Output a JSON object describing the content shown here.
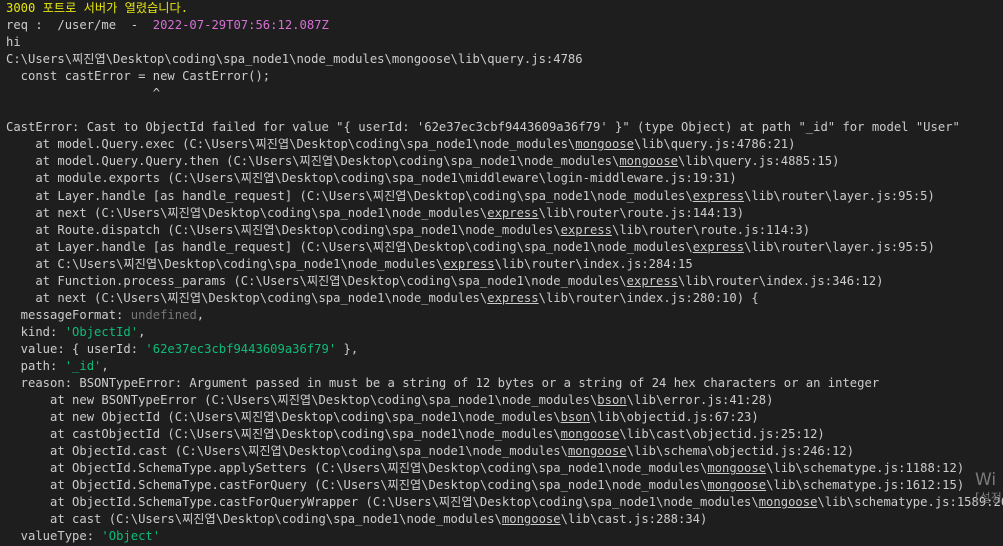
{
  "colors": {
    "background": "#1e1e1e",
    "text": "#cccccc",
    "yellow": "#e5e510",
    "magenta": "#d670d6",
    "green": "#0dbc79",
    "gray": "#767676"
  },
  "lines": [
    [
      {
        "t": "3000 포트로 서버가 열렸습니다.",
        "c": "yellow"
      }
    ],
    [
      {
        "t": "req :  /user/me  -  "
      },
      {
        "t": "2022-07-29T07:56:12.087Z",
        "c": "magenta"
      }
    ],
    [
      {
        "t": "hi"
      }
    ],
    [
      {
        "t": "C:\\Users\\찌진엽\\Desktop\\coding\\spa_node1\\node_modules\\mongoose\\lib\\query.js:4786"
      }
    ],
    [
      {
        "t": "  const castError = new CastError();"
      }
    ],
    [
      {
        "t": "                    ^"
      }
    ],
    [
      {
        "t": ""
      }
    ],
    [
      {
        "t": "CastError: Cast to ObjectId failed for value \"{ userId: '62e37ec3cbf9443609a36f79' }\" (type Object) at path \"_id\" for model \"User\""
      }
    ],
    [
      {
        "t": "    at model.Query.exec (C:\\Users\\찌진엽\\Desktop\\coding\\spa_node1\\node_modules\\"
      },
      {
        "t": "mongoose",
        "u": true
      },
      {
        "t": "\\lib\\query.js:4786:21)"
      }
    ],
    [
      {
        "t": "    at model.Query.Query.then (C:\\Users\\찌진엽\\Desktop\\coding\\spa_node1\\node_modules\\"
      },
      {
        "t": "mongoose",
        "u": true
      },
      {
        "t": "\\lib\\query.js:4885:15)"
      }
    ],
    [
      {
        "t": "    at module.exports (C:\\Users\\찌진엽\\Desktop\\coding\\spa_node1\\middleware\\login-middleware.js:19:31)"
      }
    ],
    [
      {
        "t": "    at Layer.handle [as handle_request] (C:\\Users\\찌진엽\\Desktop\\coding\\spa_node1\\node_modules\\"
      },
      {
        "t": "express",
        "u": true
      },
      {
        "t": "\\lib\\router\\layer.js:95:5)"
      }
    ],
    [
      {
        "t": "    at next (C:\\Users\\찌진엽\\Desktop\\coding\\spa_node1\\node_modules\\"
      },
      {
        "t": "express",
        "u": true
      },
      {
        "t": "\\lib\\router\\route.js:144:13)"
      }
    ],
    [
      {
        "t": "    at Route.dispatch (C:\\Users\\찌진엽\\Desktop\\coding\\spa_node1\\node_modules\\"
      },
      {
        "t": "express",
        "u": true
      },
      {
        "t": "\\lib\\router\\route.js:114:3)"
      }
    ],
    [
      {
        "t": "    at Layer.handle [as handle_request] (C:\\Users\\찌진엽\\Desktop\\coding\\spa_node1\\node_modules\\"
      },
      {
        "t": "express",
        "u": true
      },
      {
        "t": "\\lib\\router\\layer.js:95:5)"
      }
    ],
    [
      {
        "t": "    at C:\\Users\\찌진엽\\Desktop\\coding\\spa_node1\\node_modules\\"
      },
      {
        "t": "express",
        "u": true
      },
      {
        "t": "\\lib\\router\\index.js:284:15"
      }
    ],
    [
      {
        "t": "    at Function.process_params (C:\\Users\\찌진엽\\Desktop\\coding\\spa_node1\\node_modules\\"
      },
      {
        "t": "express",
        "u": true
      },
      {
        "t": "\\lib\\router\\index.js:346:12)"
      }
    ],
    [
      {
        "t": "    at next (C:\\Users\\찌진엽\\Desktop\\coding\\spa_node1\\node_modules\\"
      },
      {
        "t": "express",
        "u": true
      },
      {
        "t": "\\lib\\router\\index.js:280:10) {"
      }
    ],
    [
      {
        "t": "  messageFormat: "
      },
      {
        "t": "undefined",
        "c": "gray"
      },
      {
        "t": ","
      }
    ],
    [
      {
        "t": "  kind: "
      },
      {
        "t": "'ObjectId'",
        "c": "green"
      },
      {
        "t": ","
      }
    ],
    [
      {
        "t": "  value: { userId: "
      },
      {
        "t": "'62e37ec3cbf9443609a36f79'",
        "c": "green"
      },
      {
        "t": " },"
      }
    ],
    [
      {
        "t": "  path: "
      },
      {
        "t": "'_id'",
        "c": "green"
      },
      {
        "t": ","
      }
    ],
    [
      {
        "t": "  reason: BSONTypeError: Argument passed in must be a string of 12 bytes or a string of 24 hex characters or an integer"
      }
    ],
    [
      {
        "t": "      at new BSONTypeError (C:\\Users\\찌진엽\\Desktop\\coding\\spa_node1\\node_modules\\"
      },
      {
        "t": "bson",
        "u": true
      },
      {
        "t": "\\lib\\error.js:41:28)"
      }
    ],
    [
      {
        "t": "      at new ObjectId (C:\\Users\\찌진엽\\Desktop\\coding\\spa_node1\\node_modules\\"
      },
      {
        "t": "bson",
        "u": true
      },
      {
        "t": "\\lib\\objectid.js:67:23)"
      }
    ],
    [
      {
        "t": "      at castObjectId (C:\\Users\\찌진엽\\Desktop\\coding\\spa_node1\\node_modules\\"
      },
      {
        "t": "mongoose",
        "u": true
      },
      {
        "t": "\\lib\\cast\\objectid.js:25:12)"
      }
    ],
    [
      {
        "t": "      at ObjectId.cast (C:\\Users\\찌진엽\\Desktop\\coding\\spa_node1\\node_modules\\"
      },
      {
        "t": "mongoose",
        "u": true
      },
      {
        "t": "\\lib\\schema\\objectid.js:246:12)"
      }
    ],
    [
      {
        "t": "      at ObjectId.SchemaType.applySetters (C:\\Users\\찌진엽\\Desktop\\coding\\spa_node1\\node_modules\\"
      },
      {
        "t": "mongoose",
        "u": true
      },
      {
        "t": "\\lib\\schematype.js:1188:12)"
      }
    ],
    [
      {
        "t": "      at ObjectId.SchemaType.castForQuery (C:\\Users\\찌진엽\\Desktop\\coding\\spa_node1\\node_modules\\"
      },
      {
        "t": "mongoose",
        "u": true
      },
      {
        "t": "\\lib\\schematype.js:1612:15)"
      }
    ],
    [
      {
        "t": "      at ObjectId.SchemaType.castForQueryWrapper (C:\\Users\\찌진엽\\Desktop\\coding\\spa_node1\\node_modules\\"
      },
      {
        "t": "mongoose",
        "u": true
      },
      {
        "t": "\\lib\\schematype.js:1589:20)"
      }
    ],
    [
      {
        "t": "      at cast (C:\\Users\\찌진엽\\Desktop\\coding\\spa_node1\\node_modules\\"
      },
      {
        "t": "mongoose",
        "u": true
      },
      {
        "t": "\\lib\\cast.js:288:34)"
      }
    ],
    [
      {
        "t": "  valueType: "
      },
      {
        "t": "'Object'",
        "c": "green"
      }
    ]
  ],
  "watermark": {
    "title": "Wi",
    "subtitle": "[설정"
  }
}
